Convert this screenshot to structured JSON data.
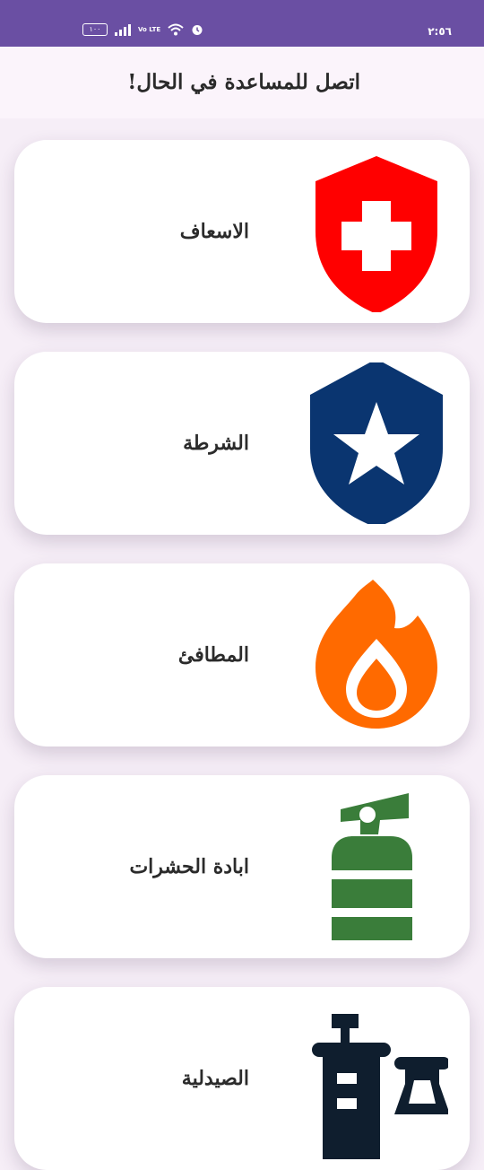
{
  "status_bar": {
    "time": "٢:٥٦",
    "battery": "١٠٠",
    "network_label": "Vo LTE"
  },
  "header": {
    "title": "اتصل للمساعدة في الحال!"
  },
  "services": [
    {
      "label": "الاسعاف",
      "icon": "ambulance-shield-icon",
      "color": "#ff0000"
    },
    {
      "label": "الشرطة",
      "icon": "police-star-shield-icon",
      "color": "#0a3570"
    },
    {
      "label": "المطافئ",
      "icon": "fire-flame-icon",
      "color": "#ff6a00"
    },
    {
      "label": "ابادة الحشرات",
      "icon": "extinguisher-sprayer-icon",
      "color": "#3a7d3a"
    },
    {
      "label": "الصيدلية",
      "icon": "pharmacy-syringe-icon",
      "color": "#0f1e2e"
    }
  ]
}
